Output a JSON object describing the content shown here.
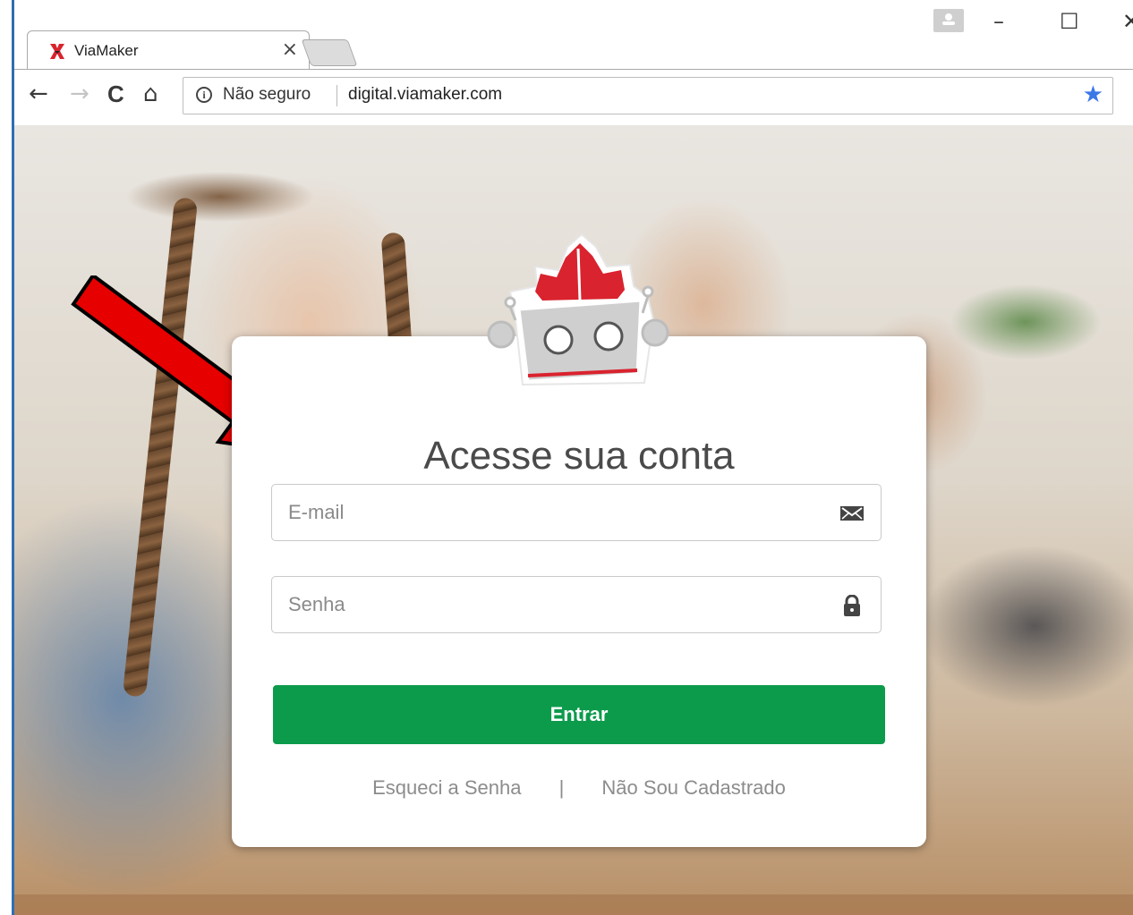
{
  "browser": {
    "tab_title": "ViaMaker",
    "tab_close": "×",
    "window_controls": {
      "minimize": "–",
      "maximize": "☐",
      "close": "✕"
    },
    "nav": {
      "back": "←",
      "forward": "→",
      "reload": "C",
      "home": "⌂"
    },
    "security_label": "Não seguro",
    "url": "digital.viamaker.com",
    "bookmark_icon": "star-icon"
  },
  "login": {
    "title": "Acesse sua conta",
    "email_placeholder": "E-mail",
    "email_value": "",
    "password_placeholder": "Senha",
    "password_value": "",
    "submit_label": "Entrar",
    "forgot_link": "Esqueci a Senha",
    "separator": "|",
    "register_link": "Não Sou Cadastrado"
  },
  "colors": {
    "primary_button": "#0b9b4b",
    "arrow": "#e60000",
    "logo_red": "#d9232e",
    "bookmark_star": "#3b78e7"
  },
  "icons": [
    "mail-icon",
    "lock-icon",
    "info-icon",
    "star-icon",
    "robot-logo-icon",
    "annotation-arrow-icon"
  ]
}
